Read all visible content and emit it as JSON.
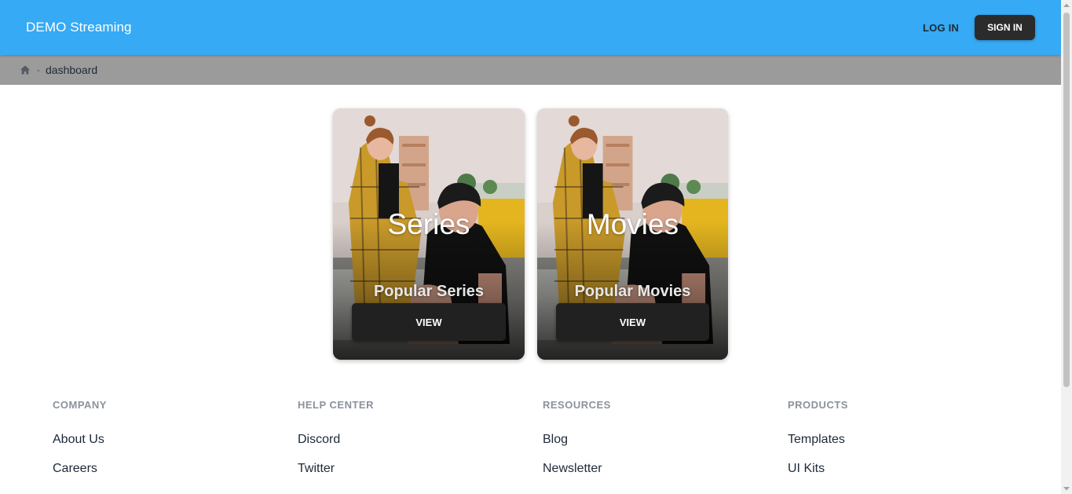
{
  "header": {
    "brand": "DEMO Streaming",
    "login_label": "LOG IN",
    "signin_label": "SIGN IN"
  },
  "breadcrumb": {
    "home_icon": "home-icon",
    "separator": "-",
    "current": "dashboard"
  },
  "cards": [
    {
      "title": "Series",
      "subtitle": "Popular Series",
      "button_label": "VIEW"
    },
    {
      "title": "Movies",
      "subtitle": "Popular Movies",
      "button_label": "VIEW"
    }
  ],
  "footer": {
    "columns": [
      {
        "heading": "COMPANY",
        "links": [
          "About Us",
          "Careers"
        ]
      },
      {
        "heading": "HELP CENTER",
        "links": [
          "Discord",
          "Twitter"
        ]
      },
      {
        "heading": "RESOURCES",
        "links": [
          "Blog",
          "Newsletter"
        ]
      },
      {
        "heading": "PRODUCTS",
        "links": [
          "Templates",
          "UI Kits"
        ]
      }
    ]
  },
  "colors": {
    "header_bg": "#36aaf4",
    "breadcrumb_bg": "#9b9b9b",
    "button_dark": "#212121"
  }
}
